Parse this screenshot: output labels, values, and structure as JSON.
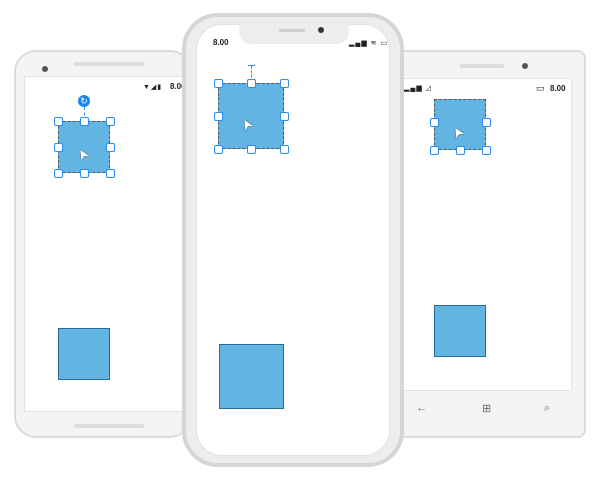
{
  "devices": {
    "android": {
      "time": "8.00",
      "status_icons": "▼◢▮"
    },
    "iphone": {
      "time": "8.00",
      "status_icons": "▂▄▆ ≋ ▭"
    },
    "windows": {
      "time": "8.00",
      "status_icons": "▂▄▆ ◿",
      "battery": "▭",
      "nav": {
        "back": "←",
        "home": "⊞",
        "search": "⌕"
      }
    }
  },
  "cursor_glyph": "➤",
  "rotate_glyph": "↻",
  "colors": {
    "shape_fill": "#62b5e2",
    "handle": "#2a8df0"
  }
}
